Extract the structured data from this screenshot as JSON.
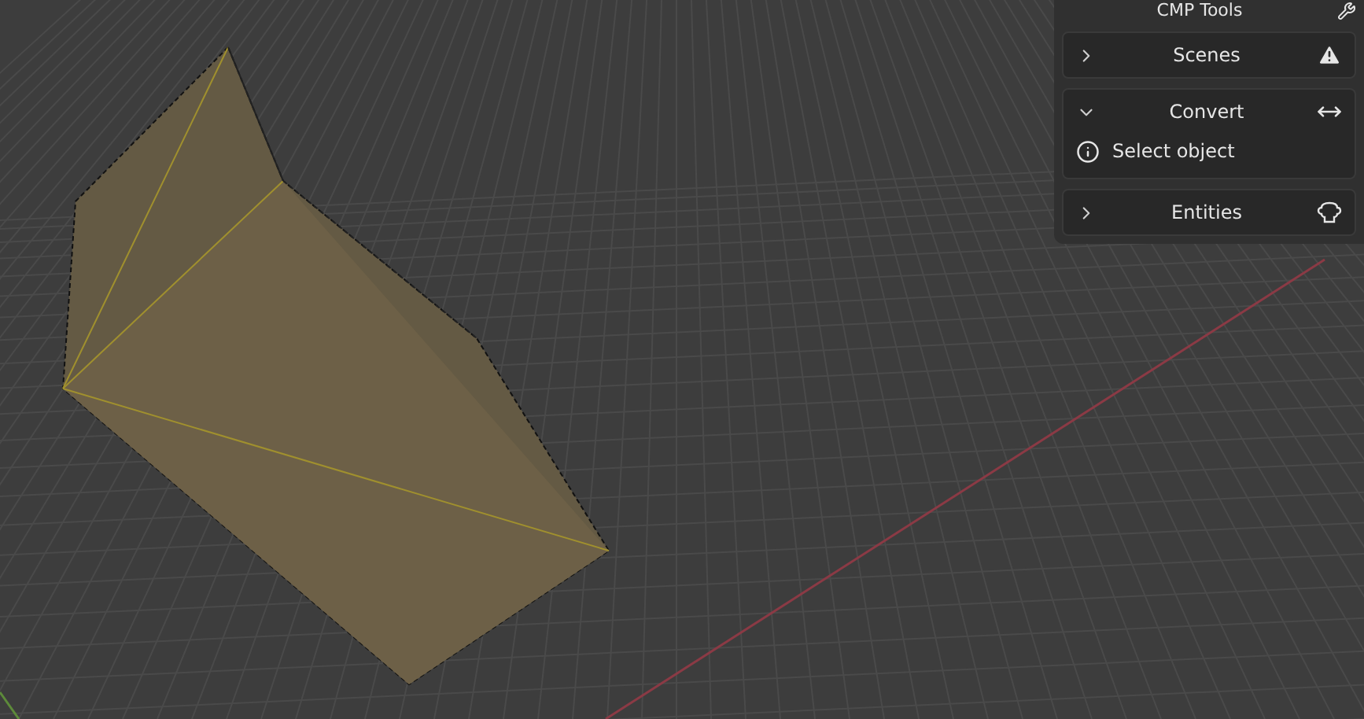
{
  "sidebar": {
    "title": "CMP Tools",
    "panels": [
      {
        "title": "Scenes",
        "expanded": false,
        "kind": "warning"
      },
      {
        "title": "Convert",
        "expanded": true,
        "kind": "arrows",
        "message": "Select object"
      },
      {
        "title": "Entities",
        "expanded": false,
        "kind": "monkey"
      }
    ]
  }
}
